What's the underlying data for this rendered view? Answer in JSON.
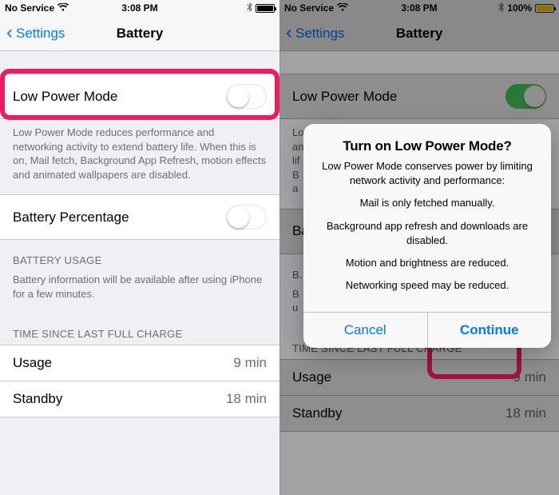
{
  "left": {
    "status": {
      "carrier": "No Service",
      "time": "3:08 PM",
      "battery_pct": ""
    },
    "nav": {
      "back": "Settings",
      "title": "Battery"
    },
    "lpm": {
      "label": "Low Power Mode",
      "on": false,
      "footer": "Low Power Mode reduces performance and networking activity to extend battery life.  When this is on, Mail fetch, Background App Refresh, motion effects and animated wallpapers are disabled."
    },
    "bpct": {
      "label": "Battery Percentage",
      "on": false
    },
    "usage": {
      "header": "BATTERY USAGE",
      "footer": "Battery information will be available after using iPhone for a few minutes."
    },
    "charge": {
      "header": "TIME SINCE LAST FULL CHARGE",
      "rows": [
        {
          "label": "Usage",
          "value": "9 min"
        },
        {
          "label": "Standby",
          "value": "18 min"
        }
      ]
    }
  },
  "right": {
    "status": {
      "carrier": "No Service",
      "time": "3:08 PM",
      "battery_pct": "100%"
    },
    "nav": {
      "back": "Settings",
      "title": "Battery"
    },
    "lpm": {
      "label": "Low Power Mode",
      "on": true
    },
    "bpct": {
      "label": "Battery Percentage"
    },
    "usage": {
      "header": "BATTER..."
    },
    "charge": {
      "header": "TIME SINCE LAST FULL CHARGE",
      "rows": [
        {
          "label": "Usage",
          "value": "9 min"
        },
        {
          "label": "Standby",
          "value": "18 min"
        }
      ]
    },
    "alert": {
      "title": "Turn on Low Power Mode?",
      "intro": "Low Power Mode conserves power by limiting network activity and performance:",
      "bullets": [
        "Mail is only fetched manually.",
        "Background app refresh and downloads are disabled.",
        "Motion and brightness are reduced.",
        "Networking speed may be reduced."
      ],
      "cancel": "Cancel",
      "continue": "Continue"
    }
  }
}
